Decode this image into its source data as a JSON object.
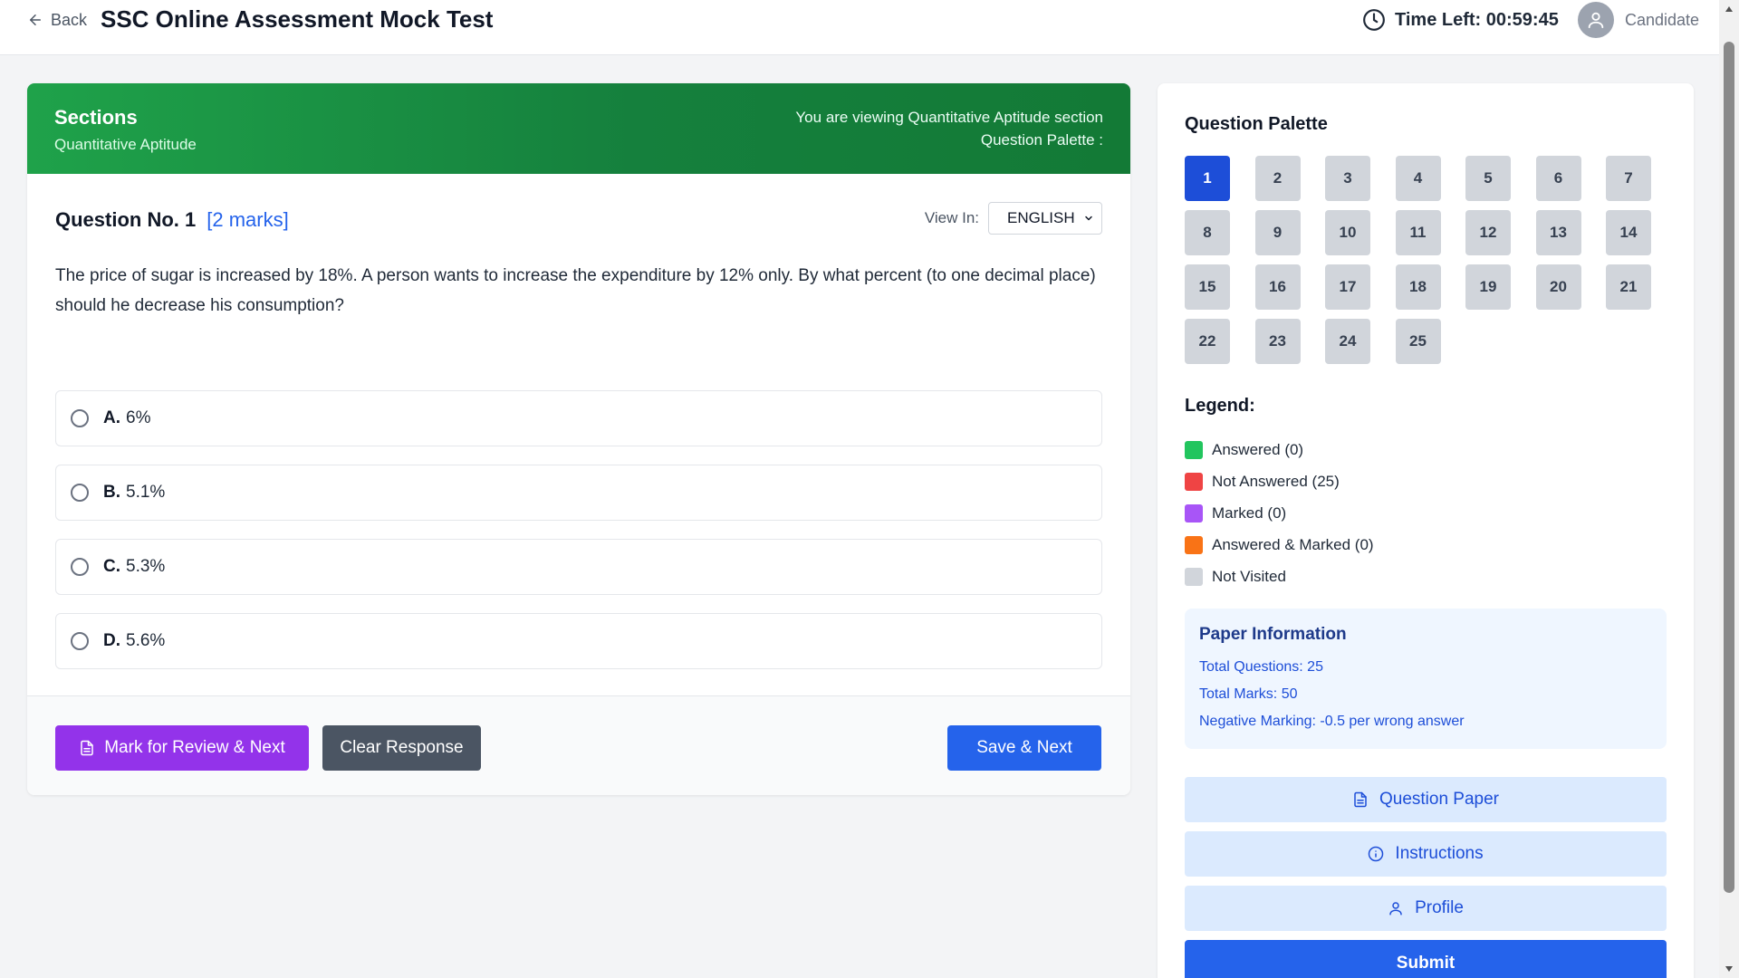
{
  "header": {
    "back_label": "Back",
    "title": "SSC Online Assessment Mock Test",
    "time_left": "Time Left: 00:59:45",
    "candidate_label": "Candidate"
  },
  "sections": {
    "title": "Sections",
    "current": "Quantitative Aptitude",
    "viewing_text": "You are viewing Quantitative Aptitude section",
    "palette_text": "Question Palette :"
  },
  "question": {
    "number_label": "Question No. 1",
    "marks_label": "[2 marks]",
    "view_in_label": "View In:",
    "language": "ENGLISH",
    "text": "The price of sugar is increased by 18%. A person wants to increase the expenditure by 12% only. By what percent (to one decimal place) should he decrease his consumption?",
    "options": [
      {
        "letter": "A.",
        "text": "6%"
      },
      {
        "letter": "B.",
        "text": "5.1%"
      },
      {
        "letter": "C.",
        "text": "5.3%"
      },
      {
        "letter": "D.",
        "text": "5.6%"
      }
    ]
  },
  "actions": {
    "mark_review": "Mark for Review & Next",
    "clear": "Clear Response",
    "save_next": "Save & Next"
  },
  "palette": {
    "title": "Question Palette",
    "current_question": 1,
    "questions": [
      "1",
      "2",
      "3",
      "4",
      "5",
      "6",
      "7",
      "8",
      "9",
      "10",
      "11",
      "12",
      "13",
      "14",
      "15",
      "16",
      "17",
      "18",
      "19",
      "20",
      "21",
      "22",
      "23",
      "24",
      "25"
    ]
  },
  "legend": {
    "title": "Legend:",
    "items": [
      {
        "label": "Answered (0)",
        "color": "#22c55e"
      },
      {
        "label": "Not Answered (25)",
        "color": "#ef4444"
      },
      {
        "label": "Marked (0)",
        "color": "#a855f7"
      },
      {
        "label": "Answered & Marked (0)",
        "color": "#f97316"
      },
      {
        "label": "Not Visited",
        "color": "#d1d5db"
      }
    ]
  },
  "paper_info": {
    "title": "Paper Information",
    "total_questions": "Total Questions: 25",
    "total_marks": "Total Marks: 50",
    "negative_marking": "Negative Marking: -0.5 per wrong answer"
  },
  "side_buttons": {
    "question_paper": "Question Paper",
    "instructions": "Instructions",
    "profile": "Profile",
    "submit": "Submit"
  },
  "colors": {
    "accent": "#2563eb",
    "section_banner": "#16a34a",
    "mark_review": "#9333ea",
    "clear": "#4b5563"
  }
}
